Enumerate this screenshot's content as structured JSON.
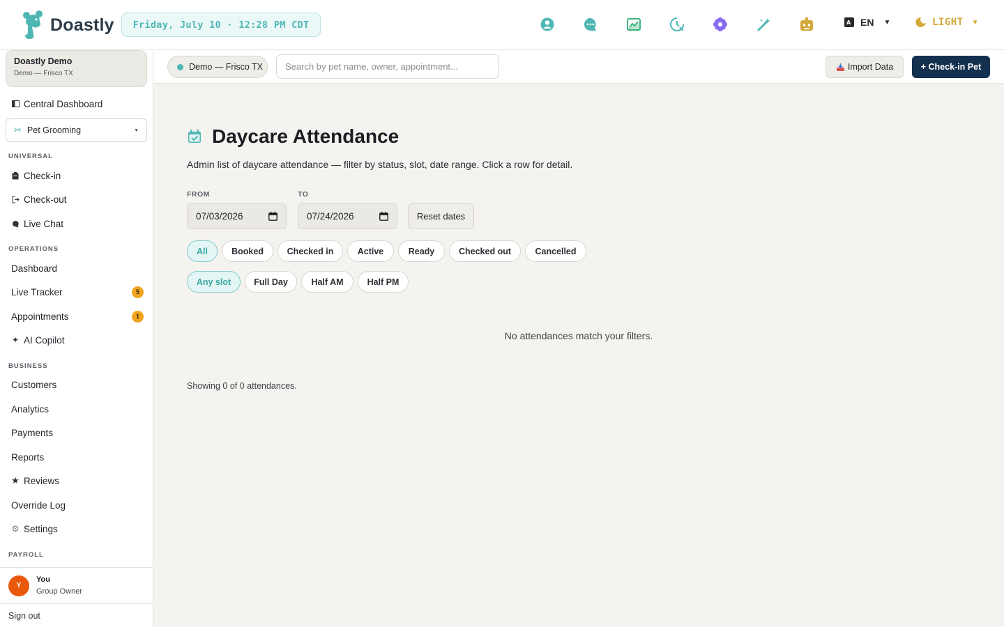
{
  "header": {
    "brand": "Doastly",
    "clock": "Friday, July 10 · 12:28 PM CDT",
    "language": "EN",
    "theme": "LIGHT"
  },
  "colors": {
    "accent_teal": "#4fb7b3",
    "navy": "#14304f",
    "badge_orange": "#f0a41f",
    "avatar_orange": "#e8590c",
    "theme_gold": "#d4a93c"
  },
  "sidebar": {
    "org_name": "Doastly Demo",
    "org_location": "Demo — Frisco TX",
    "central_dashboard": "Central Dashboard",
    "module": "Pet Grooming",
    "sections": {
      "universal": "UNIVERSAL",
      "operations": "OPERATIONS",
      "business": "BUSINESS",
      "payroll": "PAYROLL"
    },
    "universal_items": [
      "Check-in",
      "Check-out",
      "Live Chat"
    ],
    "operations_items": [
      "Dashboard",
      "Live Tracker",
      "Appointments",
      "AI Copilot"
    ],
    "live_tracker_badge": "5",
    "appointments_badge": "1",
    "business_items": [
      "Customers",
      "Analytics",
      "Payments",
      "Reports",
      "Reviews",
      "Override Log",
      "Settings"
    ],
    "user": {
      "initial": "Y",
      "name": "You",
      "role": "Group Owner"
    },
    "sign_out": "Sign out"
  },
  "subbar": {
    "location": "Demo — Frisco TX",
    "search_placeholder": "Search by pet name, owner, appointment...",
    "import_label": "Import Data",
    "checkin_label": "+ Check-in Pet"
  },
  "main": {
    "title": "Daycare Attendance",
    "description": "Admin list of daycare attendance — filter by status, slot, date range. Click a row for detail.",
    "from_label": "FROM",
    "to_label": "TO",
    "from_date": "07/03/2026",
    "to_date": "07/24/2026",
    "reset_label": "Reset dates",
    "status_filters": [
      "All",
      "Booked",
      "Checked in",
      "Active",
      "Ready",
      "Checked out",
      "Cancelled"
    ],
    "active_status": "All",
    "slot_filters": [
      "Any slot",
      "Full Day",
      "Half AM",
      "Half PM"
    ],
    "active_slot": "Any slot",
    "empty_message": "No attendances match your filters.",
    "showing": "Showing 0 of 0 attendances."
  }
}
